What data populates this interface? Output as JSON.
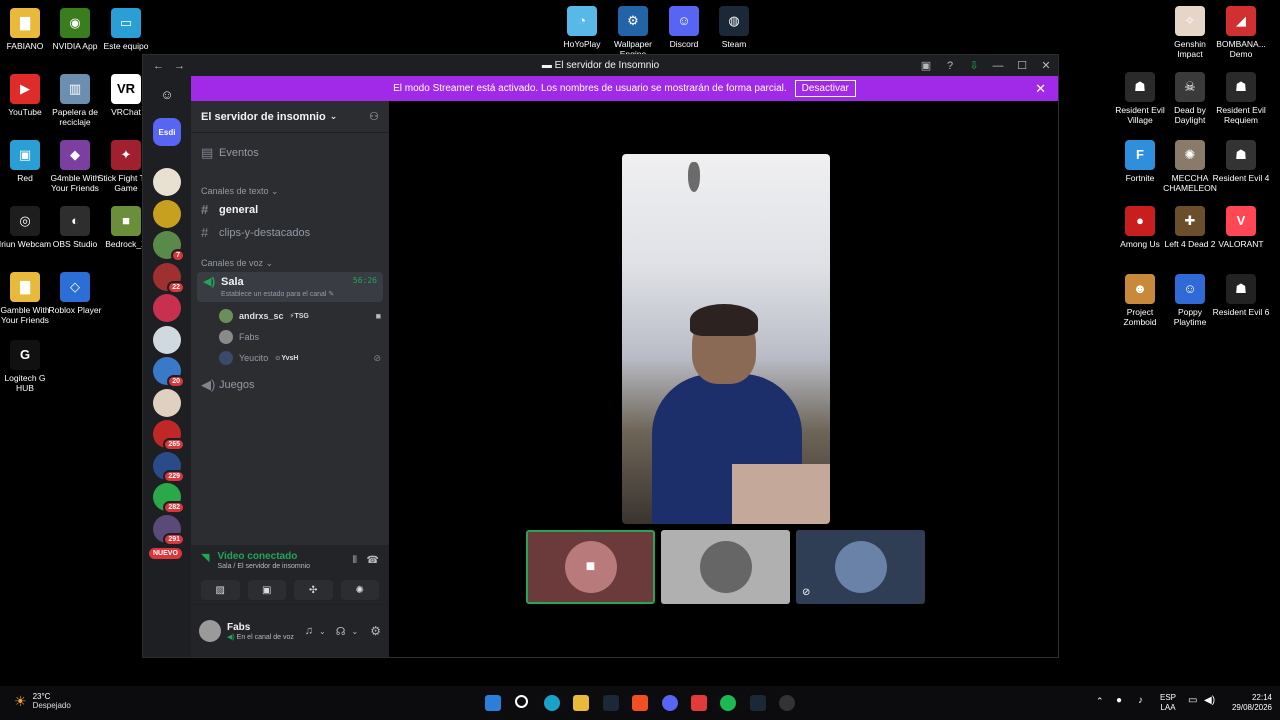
{
  "desktop": {
    "left_icons": [
      {
        "label": "FABIANO",
        "color": "#e8b93a",
        "glyph": "▇"
      },
      {
        "label": "NVIDIA App",
        "color": "#3a7d1e",
        "glyph": "◉"
      },
      {
        "label": "Este equipo",
        "color": "#2a9fd6",
        "glyph": "▭"
      },
      {
        "label": "YouTube",
        "color": "#e02b2b",
        "glyph": "▶"
      },
      {
        "label": "Papelera de reciclaje",
        "color": "#6c8fb0",
        "glyph": "▥"
      },
      {
        "label": "VRChat",
        "color": "#ffffff",
        "glyph": "VR"
      },
      {
        "label": "Red",
        "color": "#2a9fd6",
        "glyph": "▣"
      },
      {
        "label": "G4mble With Your Friends",
        "color": "#7b3fa0",
        "glyph": "◆"
      },
      {
        "label": "Stick Fight The Game",
        "color": "#a02030",
        "glyph": "✦"
      },
      {
        "label": "Iriun Webcam",
        "color": "#1e1e1e",
        "glyph": "◎"
      },
      {
        "label": "OBS Studio",
        "color": "#2e2e2e",
        "glyph": "◐"
      },
      {
        "label": "Bedrock_X",
        "color": "#6b8e3a",
        "glyph": "■"
      },
      {
        "label": "Gamble With Your Friends",
        "color": "#e8b93a",
        "glyph": "▇"
      },
      {
        "label": "Roblox Player",
        "color": "#2b6fd6",
        "glyph": "◇"
      },
      {
        "label": "Logitech G HUB",
        "color": "#111111",
        "glyph": "G"
      }
    ],
    "top_icons": [
      {
        "label": "HoYoPlay",
        "color": "#58b8e8",
        "glyph": "◔"
      },
      {
        "label": "Wallpaper Engine",
        "color": "#2363a8",
        "glyph": "⚙"
      },
      {
        "label": "Discord",
        "color": "#5865f2",
        "glyph": "☺"
      },
      {
        "label": "Steam",
        "color": "#1b2838",
        "glyph": "◍"
      }
    ],
    "right_icons": [
      {
        "label": "Genshin Impact",
        "color": "#e6d6c8",
        "glyph": "✧"
      },
      {
        "label": "BOMBANA... Demo",
        "color": "#d03030",
        "glyph": "◢"
      },
      {
        "label": "Resident Evil Village",
        "color": "#2a2a2a",
        "glyph": "☗"
      },
      {
        "label": "Dead by Daylight",
        "color": "#3a3a3a",
        "glyph": "☠"
      },
      {
        "label": "Resident Evil Requiem",
        "color": "#2a2a2a",
        "glyph": "☗"
      },
      {
        "label": "Fortnite",
        "color": "#2e8fdc",
        "glyph": "F"
      },
      {
        "label": "MECCHA CHAMELEON",
        "color": "#8a7a6a",
        "glyph": "✺"
      },
      {
        "label": "Resident Evil 4",
        "color": "#333333",
        "glyph": "☗"
      },
      {
        "label": "Among Us",
        "color": "#c81e1e",
        "glyph": "●"
      },
      {
        "label": "Left 4 Dead 2",
        "color": "#6b4f2a",
        "glyph": "✚"
      },
      {
        "label": "VALORANT",
        "color": "#ff4655",
        "glyph": "V"
      },
      {
        "label": "Project Zomboid",
        "color": "#c88a3a",
        "glyph": "☻"
      },
      {
        "label": "Poppy Playtime",
        "color": "#2f6ad6",
        "glyph": "☺"
      },
      {
        "label": "Resident Evil 6",
        "color": "#222222",
        "glyph": "☗"
      }
    ]
  },
  "window": {
    "title": "El servidor de Insomnio",
    "back": "←",
    "forward": "→",
    "help": "?",
    "minimize": "—",
    "maximize": "☐",
    "close": "✕"
  },
  "banner": {
    "text": "El modo Streamer está activado. Los nombres de usuario se mostrarán de forma parcial.",
    "button": "Desactivar",
    "close": "✕"
  },
  "rail": {
    "home_label": "Discord",
    "first_server_label": "Esdi",
    "badges": [
      "7",
      "22",
      "20",
      "265",
      "229",
      "282",
      "291"
    ],
    "nuevo": "NUEVO"
  },
  "sidebar": {
    "server_name": "El servidor de insomnio",
    "events": "Eventos",
    "text_category": "Canales de texto",
    "text_channels": [
      "general",
      "clips-y-destacados"
    ],
    "voice_category": "Canales de voz",
    "voice_channel": "Sala",
    "voice_timer": "56:26",
    "voice_status": "Establece un estado para el canal",
    "members": [
      {
        "name": "andrxs_sc",
        "tag": "TSG"
      },
      {
        "name": "Fabs",
        "tag": ""
      },
      {
        "name": "Yeucito",
        "tag": "YvsH"
      }
    ],
    "voice_channel_2": "Juegos"
  },
  "voice_panel": {
    "status": "Video conectado",
    "location": "Sala / El servidor de insomnio"
  },
  "user_panel": {
    "name": "Fabs",
    "status": "En el canal de voz"
  },
  "taskbar": {
    "weather_temp": "23°C",
    "weather_desc": "Despejado",
    "lang_top": "ESP",
    "lang_bottom": "LAA",
    "time": "22:14",
    "date": "29/08/2026"
  },
  "colors": {
    "accent": "#5865f2",
    "streamer_banner": "#a02ae8",
    "connected": "#23a55a",
    "badge": "#da373c"
  }
}
